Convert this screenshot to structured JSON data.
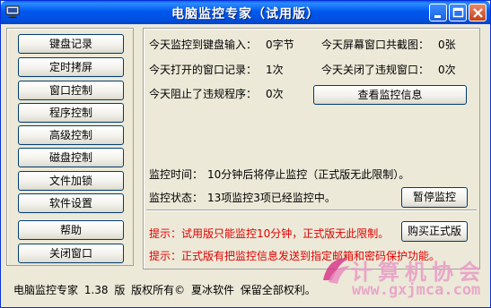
{
  "window": {
    "title": "电脑监控专家（试用版）",
    "controls": [
      "minimize-icon",
      "maximize-icon",
      "close-icon"
    ]
  },
  "sidebar": {
    "items": [
      {
        "label": "键盘记录"
      },
      {
        "label": "定时拷屏"
      },
      {
        "label": "窗口控制"
      },
      {
        "label": "程序控制"
      },
      {
        "label": "高级控制"
      },
      {
        "label": "磁盘控制"
      },
      {
        "label": "文件加锁"
      },
      {
        "label": "软件设置"
      },
      {
        "label": "帮助"
      },
      {
        "label": "关闭窗口"
      }
    ]
  },
  "stats": {
    "keyboard_label": "今天监控到键盘输入：",
    "keyboard_value": "0字节",
    "screenshots_label": "今天屏幕窗口共截图：",
    "screenshots_value": "0张",
    "windows_opened_label": "今天打开的窗口记录：",
    "windows_opened_value": "1次",
    "windows_closed_label": "今天关闭了违规窗口：",
    "windows_closed_value": "0次",
    "programs_blocked_label": "今天阻止了违规程序：",
    "programs_blocked_value": "0次",
    "view_info_button": "查看监控信息"
  },
  "monitor": {
    "time_label": "监控时间：",
    "time_value": "10分钟后将停止监控（正式版无此限制）。",
    "status_label": "监控状态：",
    "status_value": "13项监控3项已经监控中。",
    "pause_button": "暂停监控"
  },
  "notices": {
    "tip1": "提示：试用版只能监控10分钟，正式版无此限制。",
    "buy_button": "购买正式版",
    "tip2": "提示：正式版有把监控信息发送到指定邮箱和密码保护功能。"
  },
  "footer": {
    "text": "电脑监控专家  1.38 版  版权所有©  夏冰软件  保留全部权利。"
  },
  "watermark": {
    "site_name": "计算机协会",
    "url": "www.gxjmca.com"
  },
  "colors": {
    "titlebar": "#0058ee",
    "warning_text": "#e00000",
    "watermark": "#e8a0c8"
  }
}
